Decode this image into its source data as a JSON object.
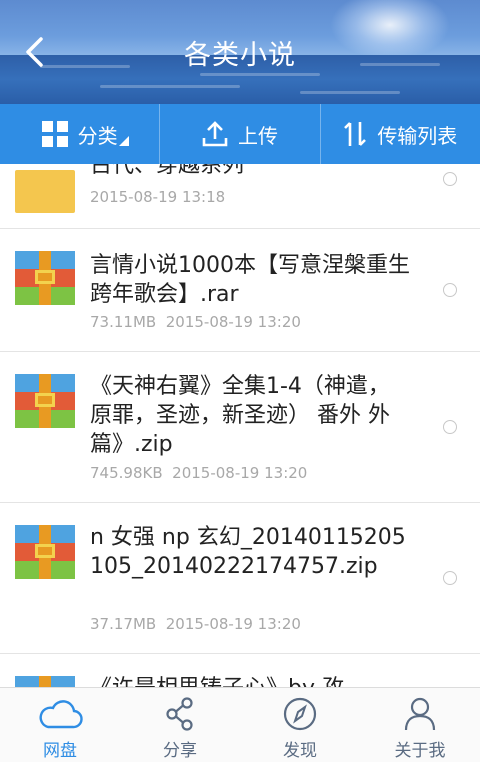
{
  "header": {
    "title": "各类小说"
  },
  "toolbar": {
    "category_label": "分类",
    "upload_label": "上传",
    "transfer_label": "传输列表"
  },
  "files": [
    {
      "name": "古代、穿越系列",
      "size": "",
      "date": "2015-08-19  13:18",
      "icon": "folder-icon"
    },
    {
      "name": "言情小说1000本【写意涅槃重生跨年歌会】.rar",
      "size": "73.11MB",
      "date": "2015-08-19  13:20",
      "icon": "archive-icon"
    },
    {
      "name": "《天神右翼》全集1-4（神遣，原罪，圣迹，新圣迹） 番外 外篇》.zip",
      "size": "745.98KB",
      "date": "2015-08-19  13:20",
      "icon": "archive-icon"
    },
    {
      "name": "n 女强 np 玄幻_20140115205105_20140222174757.zip",
      "size": "37.17MB",
      "date": "2015-08-19  13:20",
      "icon": "archive-icon"
    },
    {
      "name": "《许是相思铸子心》by 孜",
      "size": "",
      "date": "",
      "icon": "archive-icon"
    }
  ],
  "bottom_nav": [
    {
      "label": "网盘",
      "icon": "cloud-icon",
      "active": true
    },
    {
      "label": "分享",
      "icon": "share-icon",
      "active": false
    },
    {
      "label": "发现",
      "icon": "compass-icon",
      "active": false
    },
    {
      "label": "关于我",
      "icon": "person-icon",
      "active": false
    }
  ],
  "colors": {
    "accent": "#2f8de4",
    "meta_text": "#a8a8a8",
    "folder": "#f4c64e"
  }
}
